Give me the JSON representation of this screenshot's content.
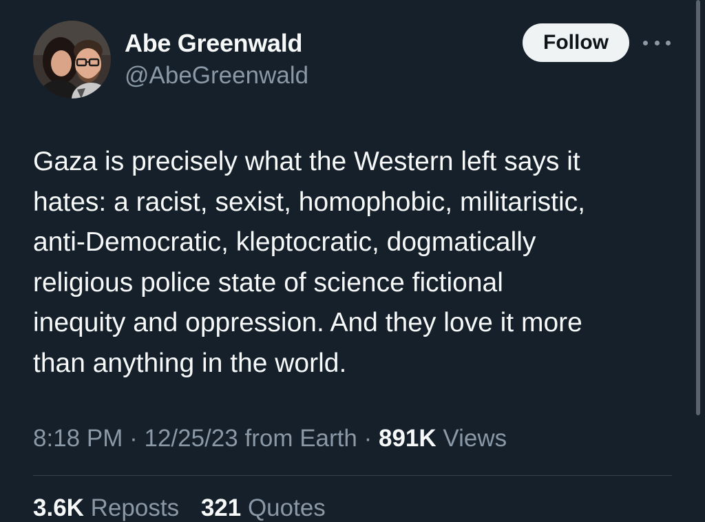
{
  "author": {
    "display_name": "Abe Greenwald",
    "handle": "@AbeGreenwald",
    "avatar_icon": "profile-photo"
  },
  "actions": {
    "follow_label": "Follow",
    "more_icon": "more-horizontal-icon"
  },
  "tweet": {
    "text_lines": [
      "Gaza is precisely what the Western left says it",
      "hates: a racist, sexist, homophobic, militaristic,",
      "anti-Democratic, kleptocratic, dogmatically",
      "religious police state of science fictional",
      "inequity and oppression. And they love it more",
      "than anything in the world."
    ]
  },
  "meta": {
    "time": "8:18 PM",
    "sep1": "·",
    "date": "12/25/23",
    "source": "from Earth",
    "sep2": "·",
    "views_count": "891K",
    "views_label": "Views"
  },
  "stats": {
    "reposts_count": "3.6K",
    "reposts_label": "Reposts",
    "quotes_count": "321",
    "quotes_label": "Quotes"
  },
  "colors": {
    "background": "#15202b",
    "text_primary": "#f7f9f9",
    "text_secondary": "#8b98a5",
    "follow_bg": "#eff3f4",
    "divider": "#38444d"
  }
}
